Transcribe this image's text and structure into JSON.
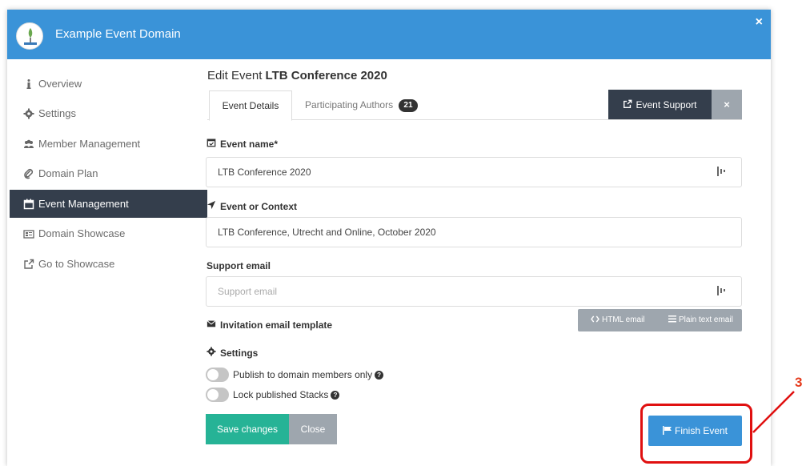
{
  "header": {
    "title": "Example Event Domain",
    "close_label": "×"
  },
  "sidebar": {
    "items": [
      {
        "label": "Overview",
        "icon": "info-icon"
      },
      {
        "label": "Settings",
        "icon": "gear-icon"
      },
      {
        "label": "Member Management",
        "icon": "users-icon"
      },
      {
        "label": "Domain Plan",
        "icon": "paperclip-icon"
      },
      {
        "label": "Event Management",
        "icon": "calendar-icon",
        "active": true
      },
      {
        "label": "Domain Showcase",
        "icon": "showcase-icon"
      },
      {
        "label": "Go to Showcase",
        "icon": "external-link-icon"
      }
    ]
  },
  "main": {
    "title_prefix": "Edit Event",
    "title_name": "LTB Conference 2020",
    "tabs": [
      {
        "label": "Event Details"
      },
      {
        "label": "Participating Authors",
        "badge": "21"
      }
    ],
    "event_support_label": "Event Support",
    "event_support_close": "×",
    "fields": {
      "event_name": {
        "label": "Event name*",
        "value": "LTB Conference 2020"
      },
      "event_context": {
        "label": "Event or Context",
        "value": "LTB Conference, Utrecht and Online, October 2020"
      },
      "support_email": {
        "label": "Support email",
        "placeholder": "Support email",
        "value": ""
      }
    },
    "invitation": {
      "label": "Invitation email template",
      "html_label": "HTML email",
      "plain_label": "Plain text email"
    },
    "settings": {
      "label": "Settings",
      "toggles": [
        {
          "label": "Publish to domain members only",
          "on": false
        },
        {
          "label": "Lock published Stacks",
          "on": false
        }
      ]
    },
    "buttons": {
      "save": "Save changes",
      "close": "Close",
      "finish": "Finish Event"
    }
  },
  "annotation": {
    "step": "3",
    "color": "#e01010"
  },
  "colors": {
    "header": "#3a93d8",
    "sidebar_active": "#343e4c",
    "save": "#26b396",
    "secondary": "#9ea6ae",
    "finish": "#3a93d8"
  }
}
